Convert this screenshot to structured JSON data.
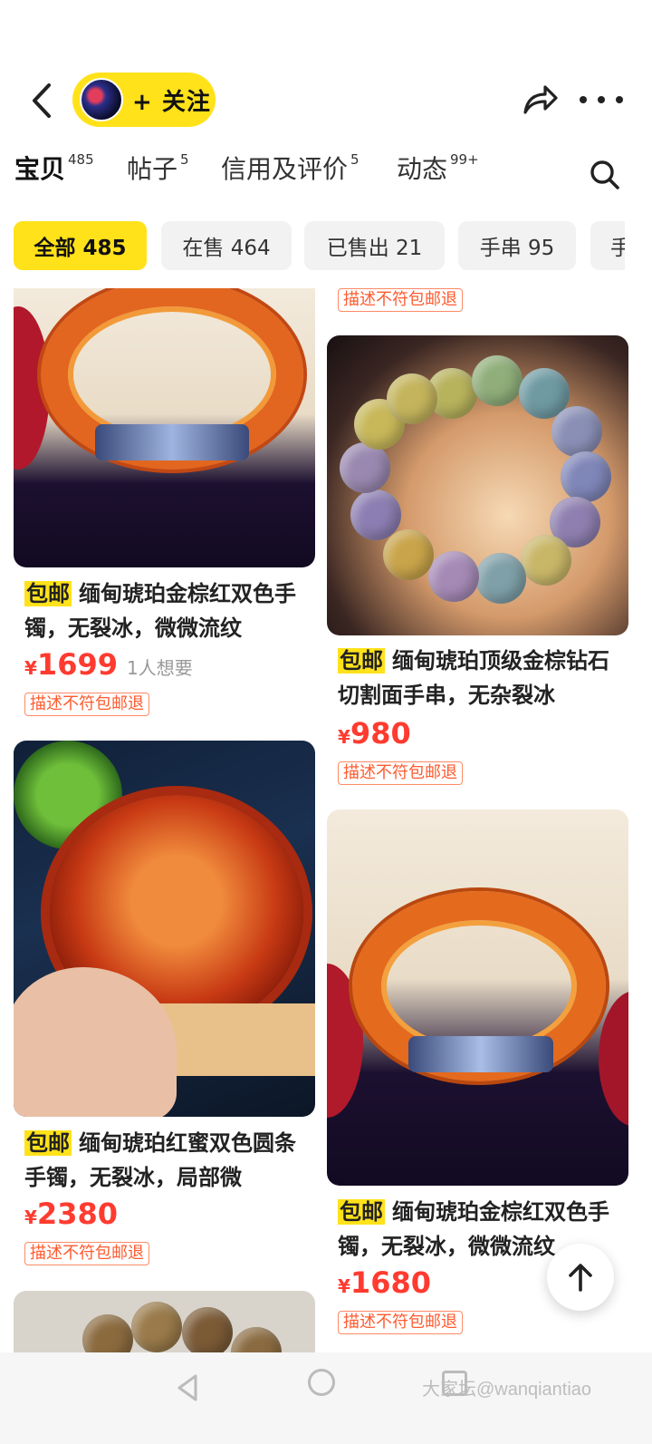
{
  "header": {
    "follow_label": "+ 关注",
    "icons": [
      "back-arrow-icon",
      "share-icon",
      "more-icon"
    ]
  },
  "tabs": [
    {
      "label": "宝贝",
      "count": "485",
      "active": true
    },
    {
      "label": "帖子",
      "count": "5",
      "active": false
    },
    {
      "label": "信用及评价",
      "count": "5",
      "active": false
    },
    {
      "label": "动态",
      "count": "99+",
      "active": false
    }
  ],
  "chips": [
    {
      "label": "全部 485",
      "active": true
    },
    {
      "label": "在售 464",
      "active": false
    },
    {
      "label": "已售出 21",
      "active": false
    },
    {
      "label": "手串 95",
      "active": false
    },
    {
      "label": "手",
      "active": false
    }
  ],
  "products": {
    "left": [
      {
        "free_tag": "包邮",
        "title": "缅甸琥珀金棕红双色手镯，无裂冰，微微流纹",
        "price_symbol": "¥",
        "price": "1699",
        "wants": "1人想要",
        "tag": "描述不符包邮退"
      },
      {
        "free_tag": "包邮",
        "title": "缅甸琥珀红蜜双色圆条手镯，无裂冰，局部微",
        "price_symbol": "¥",
        "price": "2380",
        "tag": "描述不符包邮退"
      }
    ],
    "right": [
      {
        "tag": "描述不符包邮退"
      },
      {
        "free_tag": "包邮",
        "title": "缅甸琥珀顶级金棕钻石切割面手串，无杂裂冰",
        "price_symbol": "¥",
        "price": "980",
        "tag": "描述不符包邮退"
      },
      {
        "free_tag": "包邮",
        "title": "缅甸琥珀金棕红双色手镯，无裂冰，微微流纹",
        "price_symbol": "¥",
        "price": "1680",
        "tag": "描述不符包邮退"
      }
    ]
  },
  "watermark": "大家坛@wanqiantiao",
  "colors": {
    "accent_yellow": "#ffe21a",
    "price_red": "#ff3b30",
    "tag_orange": "#ff5a2e"
  }
}
